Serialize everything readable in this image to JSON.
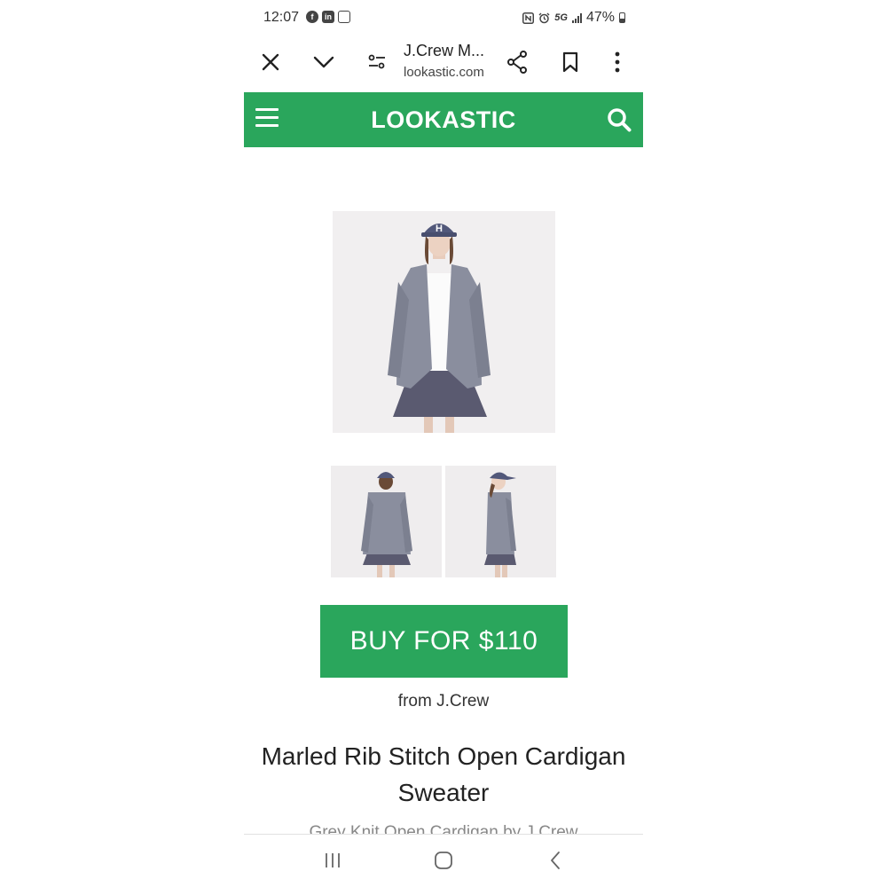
{
  "status_bar": {
    "time": "12:07",
    "network": "5G",
    "battery": "47%",
    "notification_icons": [
      "facebook-icon",
      "linkedin-icon",
      "news-icon"
    ],
    "system_icons": [
      "nfc-icon",
      "alarm-icon",
      "signal-icon",
      "battery-icon"
    ]
  },
  "browser": {
    "page_title": "J.Crew M...",
    "url": "lookastic.com",
    "buttons": [
      "close-icon",
      "chevron-down-icon",
      "tune-icon",
      "share-icon",
      "bookmark-icon",
      "more-icon"
    ]
  },
  "site_header": {
    "logo": "LOOKASTIC",
    "accent_color": "#2aa65c"
  },
  "product": {
    "buy_label": "BUY FOR $110",
    "from_label": "from J.Crew",
    "title_line1": "Marled Rib Stitch Open Cardigan",
    "title_line2": "Sweater",
    "subtitle": "Grey Knit Open Cardigan by J.Crew"
  },
  "nav_bar": {
    "buttons": [
      "recents-icon",
      "home-icon",
      "back-icon"
    ]
  }
}
